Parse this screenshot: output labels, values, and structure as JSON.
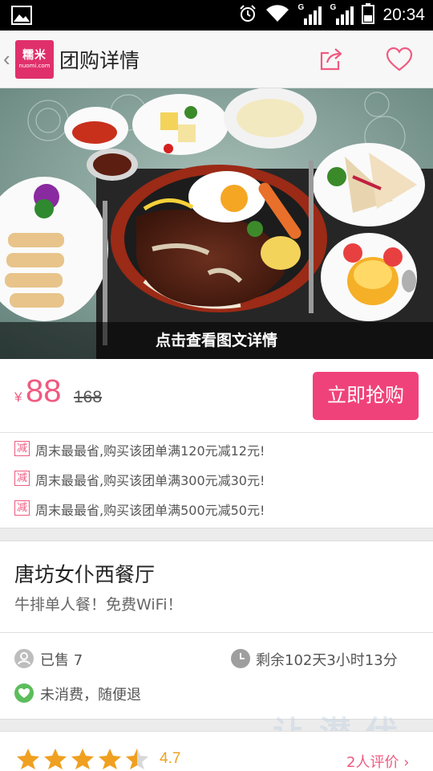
{
  "status_bar": {
    "time": "20:34",
    "network_label_1": "G",
    "network_label_2": "G",
    "icons": [
      "image-icon",
      "alarm-icon",
      "wifi-icon",
      "signal-icon",
      "battery-icon"
    ]
  },
  "header": {
    "logo_line1": "糯米",
    "logo_line2": "nuomi.com",
    "title": "团购详情",
    "back_glyph": "‹",
    "icons": [
      "back-icon",
      "share-icon",
      "heart-icon"
    ]
  },
  "hero": {
    "caption": "点击查看图文详情"
  },
  "price": {
    "currency": "¥",
    "current": "88",
    "original": "168",
    "buy_label": "立即抢购"
  },
  "promotions": [
    {
      "tag": "减",
      "text": "周末最最省,购买该团单满120元减12元!"
    },
    {
      "tag": "减",
      "text": "周末最最省,购买该团单满300元减30元!"
    },
    {
      "tag": "减",
      "text": "周末最最省,购买该团单满500元减50元!"
    }
  ],
  "shop": {
    "name": "唐坊女仆西餐厅",
    "description": "牛排单人餐！免费WiFi！"
  },
  "info": {
    "sold": "已售 7",
    "remaining": "剩余102天3小时13分",
    "refund": "未消费，随便退"
  },
  "rating": {
    "score": "4.7",
    "stars": 4.5,
    "reviews": "2人评价",
    "star_color": "#f0a020"
  },
  "watermark": "让 潜 伏 猫",
  "colors": {
    "brand": "#e0306b",
    "accent": "#f0427a",
    "price": "#f05a80"
  }
}
